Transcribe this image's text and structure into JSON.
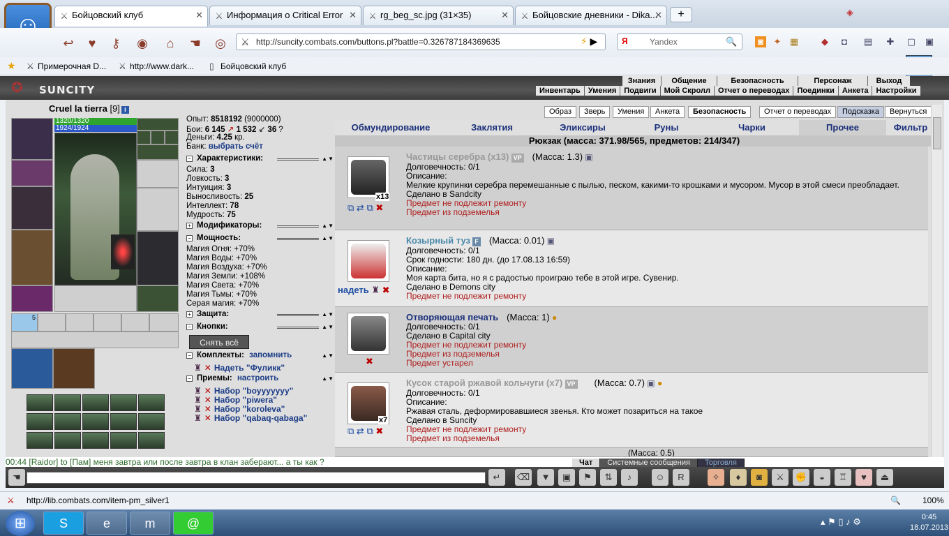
{
  "browser": {
    "tabs": [
      {
        "label": "Бойцовский клуб"
      },
      {
        "label": "Информация о Critical Error"
      },
      {
        "label": "rg_beg_sc.jpg (31×35)"
      },
      {
        "label": "Бойцовские дневники - Dika..."
      }
    ],
    "url": "http://suncity.combats.com/buttons.pl?battle=0.326787184369635",
    "search_placeholder": "Yandex",
    "search_logo": "Я",
    "bookmarks": [
      "Примерочная D...",
      "http://www.dark...",
      "Бойцовский клуб"
    ],
    "status_url": "http://lib.combats.com/item-pm_silver1",
    "zoom": "100%"
  },
  "game": {
    "city_logo": "SUNCITY",
    "menu_top": [
      "Знания",
      "Общение",
      "Безопасность",
      "Персонаж",
      "Выход"
    ],
    "menu_bottom": [
      "Инвентарь",
      "Умения",
      "Подвиги",
      "Мой Скролл",
      "Отчет о переводах",
      "Поединки",
      "Анкета",
      "Настройки"
    ],
    "char": {
      "name": "Cruel la tierra",
      "level": "[9]",
      "hp": "1320/1320",
      "mp": "1924/1924",
      "exp_label": "Опыт:",
      "exp": "8518192",
      "exp_next": "(9000000)",
      "fights_label": "Бои:",
      "wins": "6 145",
      "losses": "1 532",
      "draws": "36",
      "money_label": "Деньги:",
      "money": "4.25",
      "money_unit": "кр.",
      "bank_label": "Банк:",
      "bank_link": "выбрать счёт",
      "slot_badge": "5"
    },
    "sections": {
      "characteristics": "Характеристики:",
      "modifiers": "Модификаторы:",
      "powers": "Мощность:",
      "protection": "Защита:",
      "buttons": "Кнопки:",
      "kits": "Комплекты:",
      "kits_remember": "запомнить",
      "moves": "Приемы:",
      "moves_setup": "настроить"
    },
    "stats": [
      {
        "label": "Сила:",
        "value": "3"
      },
      {
        "label": "Ловкость:",
        "value": "3"
      },
      {
        "label": "Интуиция:",
        "value": "3"
      },
      {
        "label": "Выносливость:",
        "value": "25"
      },
      {
        "label": "Интеллект:",
        "value": "78"
      },
      {
        "label": "Мудрость:",
        "value": "75"
      }
    ],
    "powers": [
      "Магия Огня: +70%",
      "Магия Воды: +70%",
      "Магия Воздуха: +70%",
      "Магия Земли: +108%",
      "Магия Света: +70%",
      "Магия Тьмы: +70%",
      "Серая магия: +70%"
    ],
    "remove_all": "Снять всё",
    "kit_wear": "Надеть \"Фуликк\"",
    "move_sets": [
      "Набор \"boyyyyyyy\"",
      "Набор \"piwera\"",
      "Набор \"koroleva\"",
      "Набор \"qabaq-qabaga\""
    ],
    "top_buttons": [
      "Образ",
      "Зверь",
      "Умения",
      "Анкета",
      "Безопасность",
      "Отчет о переводах",
      "Подсказка",
      "Вернуться"
    ],
    "categories": [
      "Обмундирование",
      "Заклятия",
      "Эликсиры",
      "Руны",
      "Чарки",
      "Прочее",
      "Фильтр"
    ],
    "bag_title": "Рюкзак (масса: 371.98/565, предметов: 214/347)",
    "items": [
      {
        "name": "Частицы серебра (x13)",
        "badge": "VP",
        "mass": "(Масса: 1.3)",
        "count": "x13",
        "lines": [
          "Долговечность: 0/1",
          "Описание:",
          "Мелкие крупинки серебра перемешанные с пылью, песком, какими-то крошками и мусором. Мусор в этой смеси преобладает.",
          "Сделано в Sandcity"
        ],
        "red": [
          "Предмет не подлежит ремонту",
          "Предмет из подземелья"
        ]
      },
      {
        "name": "Козырный туз",
        "badge": "F",
        "mass": "(Масса: 0.01)",
        "action": "надеть",
        "lines": [
          "Долговечность: 0/1",
          "Срок годности: 180 дн. (до 17.08.13 16:59)",
          "Описание:",
          "Моя карта бита, но я с радостью проиграю тебе в этой игре. Сувенир.",
          "Сделано в Demons city"
        ],
        "red": [
          "Предмет не подлежит ремонту"
        ]
      },
      {
        "name": "Отворяющая печать",
        "mass": "(Масса: 1)",
        "lines": [
          "Долговечность: 0/1",
          "Сделано в Capital city"
        ],
        "red": [
          "Предмет не подлежит ремонту",
          "Предмет из подземелья",
          "Предмет устарел"
        ]
      },
      {
        "name": "Кусок старой ржавой кольчуги (x7)",
        "badge": "VP",
        "mass": "(Масса: 0.7)",
        "count": "x7",
        "lines": [
          "Долговечность: 0/1",
          "Описание:",
          "Ржавая сталь, деформировавшиеся звенья. Кто может позариться на такое",
          "Сделано в Suncity"
        ],
        "red": [
          "Предмет не подлежит ремонту",
          "Предмет из подземелья"
        ]
      }
    ],
    "next_item_mass": "(Масса: 0.5)",
    "chat_line": "00:44 [Raidor] to [Пам] меня завтра или после завтра в клан заберают... а ты как ?",
    "chat_tabs": [
      "Чат",
      "Системные сообщения",
      "Торговля"
    ]
  },
  "taskbar": {
    "time": "0:45",
    "date": "18.07.2013"
  }
}
